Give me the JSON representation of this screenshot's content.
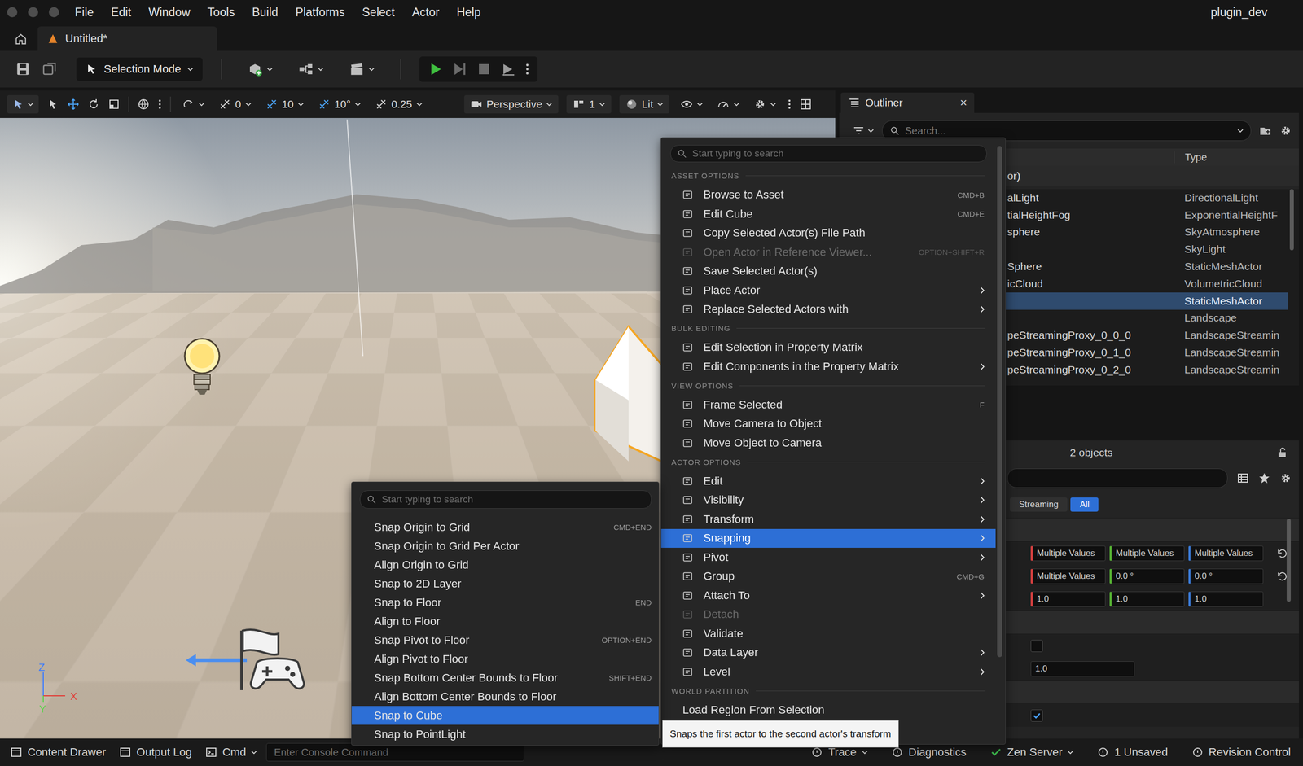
{
  "window": {
    "menu": [
      "File",
      "Edit",
      "Window",
      "Tools",
      "Build",
      "Platforms",
      "Select",
      "Actor",
      "Help"
    ],
    "project": "plugin_dev"
  },
  "tabs": [
    {
      "label": "Untitled*",
      "selected": true
    }
  ],
  "toolbar": {
    "mode": "Selection Mode"
  },
  "viewport_toolbar": {
    "snaps": [
      {
        "value": "0",
        "on": false
      },
      {
        "value": "10",
        "on": true
      },
      {
        "value": "10°",
        "on": true
      },
      {
        "value": "0.25",
        "on": false
      }
    ],
    "view": "Perspective",
    "layout": "1",
    "lighting": "Lit"
  },
  "viewport": {
    "axes": [
      {
        "label": "Z",
        "color": "#3b7bff"
      },
      {
        "label": "X",
        "color": "#e0403a"
      },
      {
        "label": "Y",
        "color": "#5bd04b"
      }
    ]
  },
  "outliner": {
    "title": "Outliner",
    "close": "×",
    "search_placeholder": "Search...",
    "columns": [
      "Type"
    ],
    "pinned": {
      "label": "or)"
    },
    "rows": [
      {
        "label": "alLight",
        "type": "DirectionalLight",
        "selected": false
      },
      {
        "label": "tialHeightFog",
        "type": "ExponentialHeightF",
        "selected": false
      },
      {
        "label": "sphere",
        "type": "SkyAtmosphere",
        "selected": false
      },
      {
        "label": "",
        "type": "SkyLight",
        "selected": false
      },
      {
        "label": "Sphere",
        "type": "StaticMeshActor",
        "selected": false
      },
      {
        "label": "icCloud",
        "type": "VolumetricCloud",
        "selected": false
      },
      {
        "label": "",
        "type": "StaticMeshActor",
        "selected": true
      },
      {
        "label": "",
        "type": "Landscape",
        "selected": false
      },
      {
        "label": "peStreamingProxy_0_0_0",
        "type": "LandscapeStreamin",
        "selected": false
      },
      {
        "label": "peStreamingProxy_0_1_0",
        "type": "LandscapeStreamin",
        "selected": false
      },
      {
        "label": "peStreamingProxy_0_2_0",
        "type": "LandscapeStreamin",
        "selected": false
      }
    ]
  },
  "details": {
    "count": "2 objects",
    "filters": [
      {
        "label": "Streaming",
        "selected": false
      },
      {
        "label": "All",
        "selected": true
      }
    ],
    "axis_colors": [
      "#d23f3f",
      "#55b033",
      "#3a7ad6"
    ],
    "properties": [
      {
        "kind": "divider"
      },
      {
        "kind": "vector",
        "values": [
          "Multiple Values",
          "Multiple Values",
          "Multiple Values"
        ],
        "resettable": true
      },
      {
        "kind": "vector",
        "values": [
          "Multiple Values",
          "0.0 °",
          "0.0 °"
        ],
        "resettable": true
      },
      {
        "kind": "vector",
        "values": [
          "1.0",
          "1.0",
          "1.0"
        ],
        "resettable": false
      },
      {
        "kind": "divider"
      },
      {
        "kind": "checkbox",
        "checked": false
      },
      {
        "kind": "number",
        "value": "1.0"
      },
      {
        "kind": "divider"
      },
      {
        "kind": "checkbox",
        "checked": true
      }
    ]
  },
  "context_menu": {
    "search_placeholder": "Start typing to search",
    "rows": [
      {
        "kind": "header",
        "label": "ASSET OPTIONS",
        "shortcut": "",
        "submenu": false,
        "disabled": false,
        "selected": false
      },
      {
        "kind": "item",
        "label": "Browse to Asset",
        "shortcut": "CMD+B",
        "submenu": false,
        "disabled": false,
        "selected": false
      },
      {
        "kind": "item",
        "label": "Edit Cube",
        "shortcut": "CMD+E",
        "submenu": false,
        "disabled": false,
        "selected": false
      },
      {
        "kind": "item",
        "label": "Copy Selected Actor(s) File Path",
        "shortcut": "",
        "submenu": false,
        "disabled": false,
        "selected": false
      },
      {
        "kind": "item",
        "label": "Open Actor in Reference Viewer...",
        "shortcut": "OPTION+SHIFT+R",
        "submenu": false,
        "disabled": true,
        "selected": false
      },
      {
        "kind": "item",
        "label": "Save Selected Actor(s)",
        "shortcut": "",
        "submenu": false,
        "disabled": false,
        "selected": false
      },
      {
        "kind": "item",
        "label": "Place Actor",
        "shortcut": "",
        "submenu": true,
        "disabled": false,
        "selected": false
      },
      {
        "kind": "item",
        "label": "Replace Selected Actors with",
        "shortcut": "",
        "submenu": true,
        "disabled": false,
        "selected": false
      },
      {
        "kind": "header",
        "label": "BULK EDITING",
        "shortcut": "",
        "submenu": false,
        "disabled": false,
        "selected": false
      },
      {
        "kind": "item",
        "label": "Edit Selection in Property Matrix",
        "shortcut": "",
        "submenu": false,
        "disabled": false,
        "selected": false
      },
      {
        "kind": "item",
        "label": "Edit Components in the Property Matrix",
        "shortcut": "",
        "submenu": true,
        "disabled": false,
        "selected": false
      },
      {
        "kind": "header",
        "label": "VIEW OPTIONS",
        "shortcut": "",
        "submenu": false,
        "disabled": false,
        "selected": false
      },
      {
        "kind": "item",
        "label": "Frame Selected",
        "shortcut": "F",
        "submenu": false,
        "disabled": false,
        "selected": false
      },
      {
        "kind": "item",
        "label": "Move Camera to Object",
        "shortcut": "",
        "submenu": false,
        "disabled": false,
        "selected": false
      },
      {
        "kind": "item",
        "label": "Move Object to Camera",
        "shortcut": "",
        "submenu": false,
        "disabled": false,
        "selected": false
      },
      {
        "kind": "header",
        "label": "ACTOR OPTIONS",
        "shortcut": "",
        "submenu": false,
        "disabled": false,
        "selected": false
      },
      {
        "kind": "item",
        "label": "Edit",
        "shortcut": "",
        "submenu": true,
        "disabled": false,
        "selected": false
      },
      {
        "kind": "item",
        "label": "Visibility",
        "shortcut": "",
        "submenu": true,
        "disabled": false,
        "selected": false
      },
      {
        "kind": "item",
        "label": "Transform",
        "shortcut": "",
        "submenu": true,
        "disabled": false,
        "selected": false
      },
      {
        "kind": "item",
        "label": "Snapping",
        "shortcut": "",
        "submenu": true,
        "disabled": false,
        "selected": true
      },
      {
        "kind": "item",
        "label": "Pivot",
        "shortcut": "",
        "submenu": true,
        "disabled": false,
        "selected": false
      },
      {
        "kind": "item",
        "label": "Group",
        "shortcut": "CMD+G",
        "submenu": false,
        "disabled": false,
        "selected": false
      },
      {
        "kind": "item",
        "label": "Attach To",
        "shortcut": "",
        "submenu": true,
        "disabled": false,
        "selected": false
      },
      {
        "kind": "item",
        "label": "Detach",
        "shortcut": "",
        "submenu": false,
        "disabled": true,
        "selected": false
      },
      {
        "kind": "item",
        "label": "Validate",
        "shortcut": "",
        "submenu": false,
        "disabled": false,
        "selected": false
      },
      {
        "kind": "item",
        "label": "Data Layer",
        "shortcut": "",
        "submenu": true,
        "disabled": false,
        "selected": false
      },
      {
        "kind": "item",
        "label": "Level",
        "shortcut": "",
        "submenu": true,
        "disabled": false,
        "selected": false
      },
      {
        "kind": "header",
        "label": "WORLD PARTITION",
        "shortcut": "",
        "submenu": false,
        "disabled": false,
        "selected": false
      },
      {
        "kind": "plain",
        "label": "Load Region From Selection",
        "shortcut": "",
        "submenu": false,
        "disabled": false,
        "selected": false
      }
    ]
  },
  "snapping_menu": {
    "search_placeholder": "Start typing to search",
    "items": [
      {
        "label": "Snap Origin to Grid",
        "shortcut": "CMD+END",
        "selected": false
      },
      {
        "label": "Snap Origin to Grid Per Actor",
        "shortcut": "",
        "selected": false
      },
      {
        "label": "Align Origin to Grid",
        "shortcut": "",
        "selected": false
      },
      {
        "label": "Snap to 2D Layer",
        "shortcut": "",
        "selected": false
      },
      {
        "label": "Snap to Floor",
        "shortcut": "END",
        "selected": false
      },
      {
        "label": "Align to Floor",
        "shortcut": "",
        "selected": false
      },
      {
        "label": "Snap Pivot to Floor",
        "shortcut": "OPTION+END",
        "selected": false
      },
      {
        "label": "Align Pivot to Floor",
        "shortcut": "",
        "selected": false
      },
      {
        "label": "Snap Bottom Center Bounds to Floor",
        "shortcut": "SHIFT+END",
        "selected": false
      },
      {
        "label": "Align Bottom Center Bounds to Floor",
        "shortcut": "",
        "selected": false
      },
      {
        "label": "Snap to Cube",
        "shortcut": "",
        "selected": true
      },
      {
        "label": "Snap to PointLight",
        "shortcut": "",
        "selected": false
      }
    ]
  },
  "tooltip": {
    "text": "Snaps the first actor to the second actor's transform"
  },
  "status_bar": {
    "left": [
      "Content Drawer",
      "Output Log"
    ],
    "cmd": "Cmd",
    "console_placeholder": "Enter Console Command",
    "right": [
      {
        "label": "Trace",
        "dropdown": true,
        "ok": false
      },
      {
        "label": "Diagnostics",
        "dropdown": false,
        "ok": false
      },
      {
        "label": "Zen Server",
        "dropdown": true,
        "ok": true
      },
      {
        "label": "1 Unsaved",
        "dropdown": false,
        "ok": false
      },
      {
        "label": "Revision Control",
        "dropdown": false,
        "ok": false
      }
    ]
  }
}
